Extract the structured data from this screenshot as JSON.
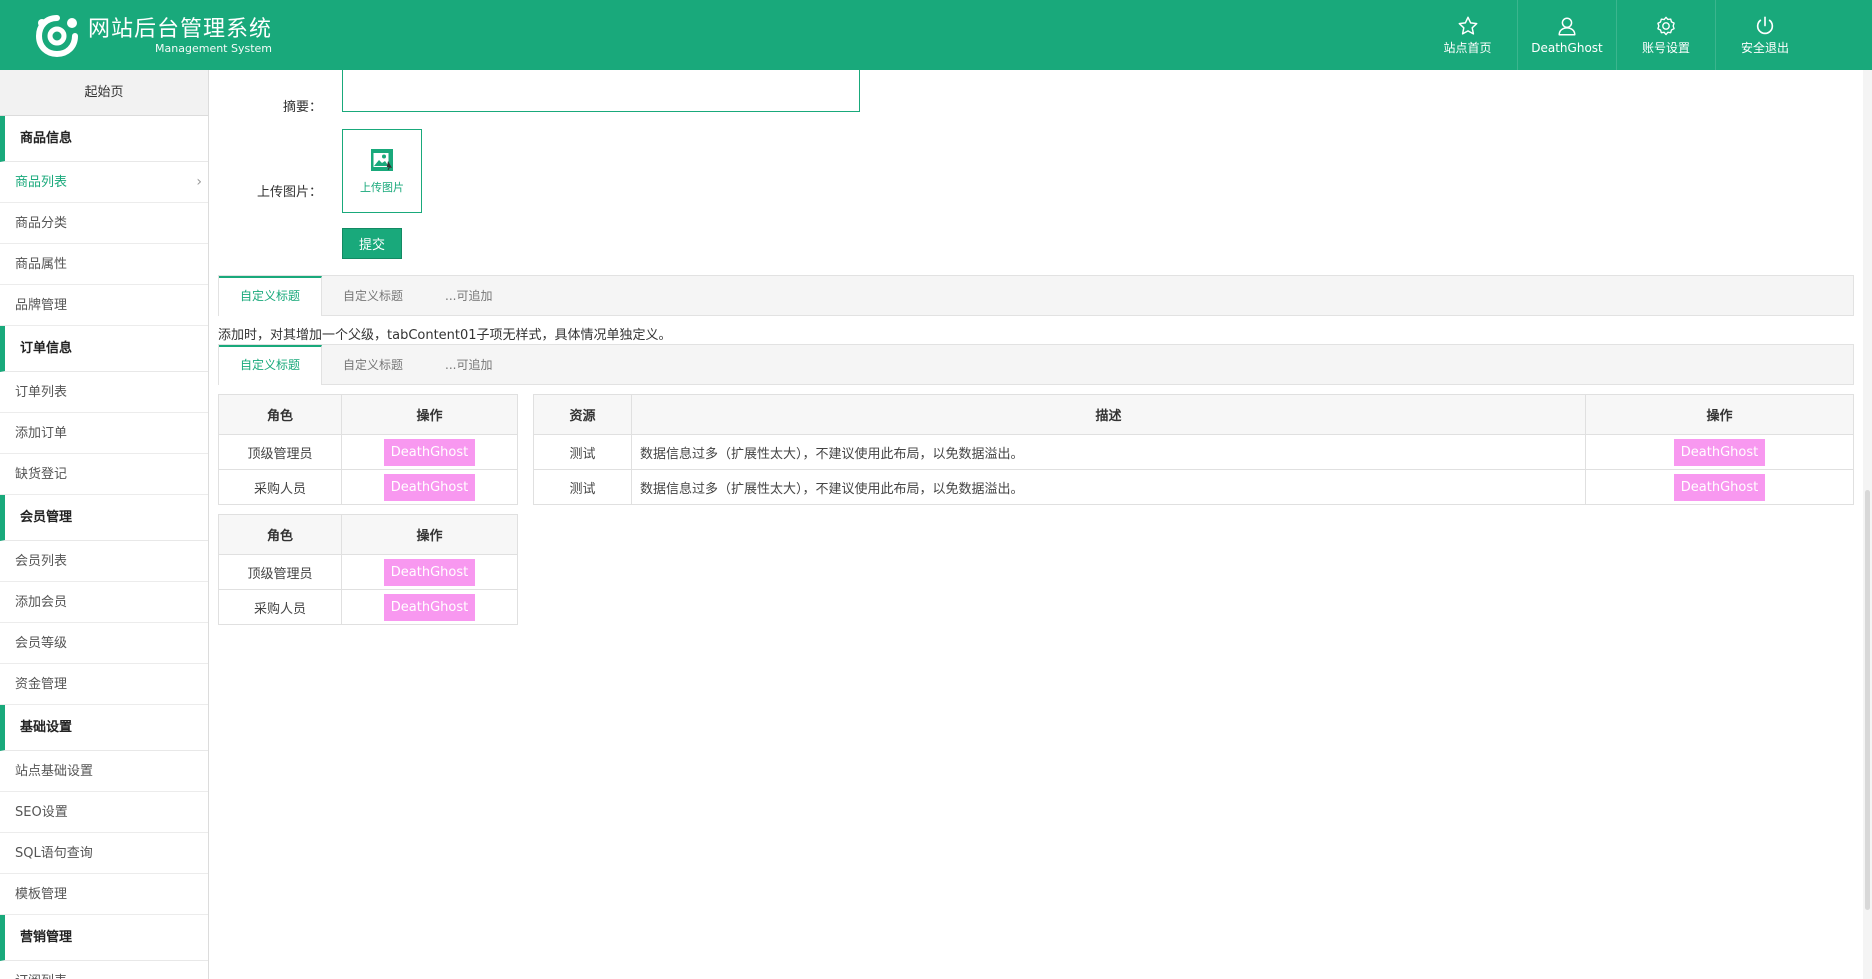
{
  "header": {
    "title": "网站后台管理系统",
    "subtitle": "Management System",
    "nav": [
      {
        "label": "站点首页",
        "icon": "star-icon"
      },
      {
        "label": "DeathGhost",
        "icon": "user-icon"
      },
      {
        "label": "账号设置",
        "icon": "gear-icon"
      },
      {
        "label": "安全退出",
        "icon": "power-icon"
      }
    ],
    "accent": "#19a97b"
  },
  "sidebar": {
    "start_page": "起始页",
    "groups": [
      {
        "title": "商品信息",
        "items": [
          "商品列表",
          "商品分类",
          "商品属性",
          "品牌管理"
        ]
      },
      {
        "title": "订单信息",
        "items": [
          "订单列表",
          "添加订单",
          "缺货登记"
        ]
      },
      {
        "title": "会员管理",
        "items": [
          "会员列表",
          "添加会员",
          "会员等级",
          "资金管理"
        ]
      },
      {
        "title": "基础设置",
        "items": [
          "站点基础设置",
          "SEO设置",
          "SQL语句查询",
          "模板管理"
        ]
      },
      {
        "title": "营销管理",
        "items": [
          "订阅列表"
        ]
      }
    ],
    "active_item": "商品列表"
  },
  "form": {
    "summary_label": "摘要：",
    "upload_label": "上传图片：",
    "upload_button_text": "上传图片",
    "submit_label": "提交"
  },
  "tabs1": [
    "自定义标题",
    "自定义标题",
    "...可追加"
  ],
  "note": "添加时，对其增加一个父级，tabContent01子项无样式，具体情况单独定义。",
  "tabs2": [
    "自定义标题",
    "自定义标题",
    "...可追加"
  ],
  "role_table": {
    "headers": [
      "角色",
      "操作"
    ],
    "rows": [
      {
        "role": "顶级管理员",
        "action": "DeathGhost"
      },
      {
        "role": "采购人员",
        "action": "DeathGhost"
      }
    ]
  },
  "resource_table": {
    "headers": [
      "资源",
      "描述",
      "操作"
    ],
    "rows": [
      {
        "resource": "测试",
        "desc": "数据信息过多（扩展性太大），不建议使用此布局，以免数据溢出。",
        "action": "DeathGhost"
      },
      {
        "resource": "测试",
        "desc": "数据信息过多（扩展性太大），不建议使用此布局，以免数据溢出。",
        "action": "DeathGhost"
      }
    ]
  },
  "role_table2": {
    "headers": [
      "角色",
      "操作"
    ],
    "rows": [
      {
        "role": "顶级管理员",
        "action": "DeathGhost"
      },
      {
        "role": "采购人员",
        "action": "DeathGhost"
      }
    ]
  }
}
